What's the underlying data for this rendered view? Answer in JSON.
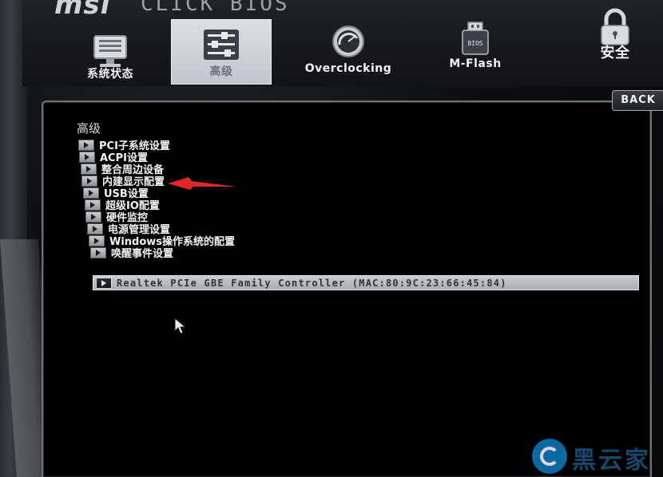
{
  "header": {
    "logo": "msi",
    "logo_sub": "CLICK BIOS"
  },
  "nav": {
    "tabs": [
      {
        "label": "系统状态",
        "icon": "monitor-icon"
      },
      {
        "label": "高级",
        "icon": "settings-sliders-icon",
        "active": true
      },
      {
        "label": "Overclocking",
        "icon": "speedometer-icon"
      },
      {
        "label": "M-Flash",
        "icon": "usb-flash-icon"
      },
      {
        "label": "安全",
        "icon": "padlock-icon"
      }
    ]
  },
  "back_label": "BACK",
  "section_title": "高级",
  "menu": {
    "items": [
      {
        "label": "PCI子系统设置"
      },
      {
        "label": "ACPI设置"
      },
      {
        "label": "整合周边设备"
      },
      {
        "label": "内建显示配置"
      },
      {
        "label": "USB设置"
      },
      {
        "label": "超级IO配置"
      },
      {
        "label": "硬件监控"
      },
      {
        "label": "电源管理设置"
      },
      {
        "label": "Windows操作系统的配置"
      },
      {
        "label": "唤醒事件设置"
      }
    ]
  },
  "device": {
    "label": "Realtek PCIe GBE Family Controller (MAC:80:9C:23:66:45:84)"
  },
  "watermark": {
    "text": "黑云家"
  },
  "colors": {
    "annotation_arrow": "#e0262b",
    "active_tab": "#cfd3d8",
    "selected_row": "#b9bcc1"
  }
}
